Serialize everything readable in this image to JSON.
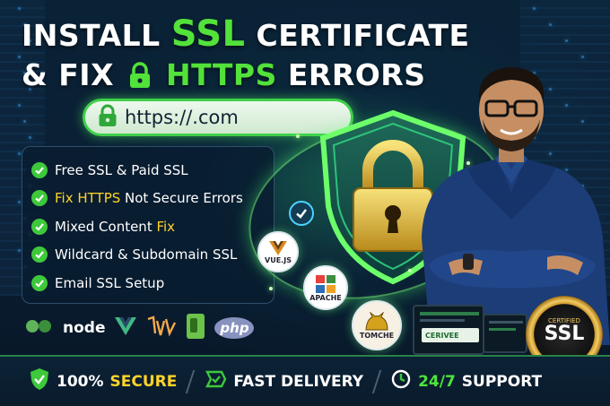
{
  "headline": {
    "line1_pre": "INSTALL",
    "line1_accent": "SSL",
    "line1_post": "CERTIFICATE",
    "line2_pre": "& FIX",
    "line2_accent": "HTTPS",
    "line2_post": "ERRORS"
  },
  "urlbar": {
    "text": "https://.com"
  },
  "features": [
    {
      "pre": "Free SSL & Paid SSL",
      "accent": "",
      "post": ""
    },
    {
      "pre": "",
      "accent": "Fix HTTPS",
      "post": " Not Secure Errors"
    },
    {
      "pre": "Mixed Content ",
      "accent": "Fix",
      "post": ""
    },
    {
      "pre": "Wildcard & Subdomain SSL",
      "accent": "",
      "post": ""
    },
    {
      "pre": "Email SSL Setup",
      "accent": "",
      "post": ""
    }
  ],
  "badges": {
    "vue": "VUE.JS",
    "apache": "APACHE",
    "tomcat": "TOMCHE"
  },
  "logos": {
    "node": "node",
    "php": "php"
  },
  "dashboard": {
    "label": "CERIVEE"
  },
  "seal": {
    "top": "CERTIFIED",
    "main": "SSL"
  },
  "bottom": {
    "secure_num": "100%",
    "secure_word": "SECURE",
    "delivery": "FAST DELIVERY",
    "support_num": "24/7",
    "support_word": "SUPPORT"
  },
  "colors": {
    "accent_green": "#52e23a",
    "accent_yellow": "#ffd42a",
    "bg": "#0b1e33"
  },
  "icons": [
    "lock-icon",
    "check-icon",
    "shield-icon",
    "delivery-icon",
    "support-icon"
  ]
}
